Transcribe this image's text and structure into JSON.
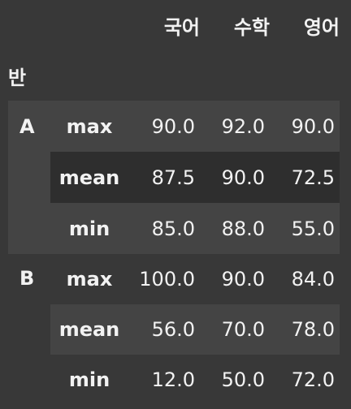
{
  "table": {
    "columns": [
      "국어",
      "수학",
      "영어"
    ],
    "index_name": "반",
    "groups": [
      {
        "name": "A",
        "rows": [
          {
            "stat": "max",
            "values": [
              "90.0",
              "92.0",
              "90.0"
            ]
          },
          {
            "stat": "mean",
            "values": [
              "87.5",
              "90.0",
              "72.5"
            ]
          },
          {
            "stat": "min",
            "values": [
              "85.0",
              "88.0",
              "55.0"
            ]
          }
        ]
      },
      {
        "name": "B",
        "rows": [
          {
            "stat": "max",
            "values": [
              "100.0",
              "90.0",
              "84.0"
            ]
          },
          {
            "stat": "mean",
            "values": [
              "56.0",
              "70.0",
              "78.0"
            ]
          },
          {
            "stat": "min",
            "values": [
              "12.0",
              "50.0",
              "72.0"
            ]
          }
        ]
      }
    ]
  },
  "colors": {
    "background": "#383838",
    "group_a_band": "#444444",
    "stripe_dark": "#2e2e2e",
    "text": "#f2f2f2"
  }
}
